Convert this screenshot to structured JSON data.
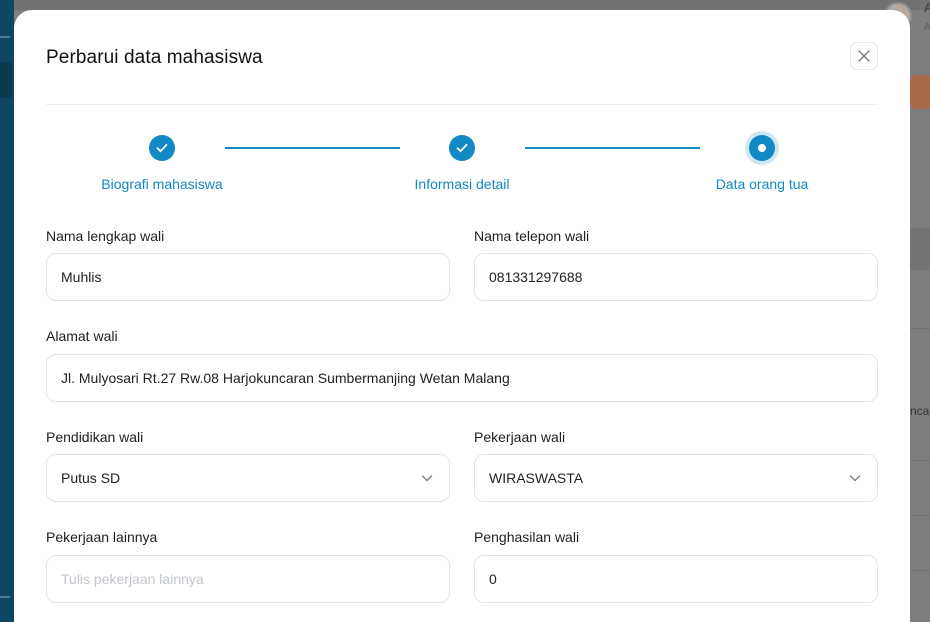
{
  "background": {
    "user_initial": "A",
    "user_sub": "A",
    "partial_text": "ncar"
  },
  "modal": {
    "title": "Perbarui data mahasiswa",
    "close_icon": "close-icon",
    "steps": [
      {
        "label": "Biografi mahasiswa",
        "state": "completed",
        "icon": "check-icon"
      },
      {
        "label": "Informasi detail",
        "state": "completed",
        "icon": "check-icon"
      },
      {
        "label": "Data orang tua",
        "state": "active",
        "icon": "dot-icon"
      }
    ],
    "form": {
      "nama_lengkap_wali": {
        "label": "Nama lengkap wali",
        "value": "Muhlis"
      },
      "nama_telepon_wali": {
        "label": "Nama telepon wali",
        "value": "081331297688"
      },
      "alamat_wali": {
        "label": "Alamat wali",
        "value": "Jl. Mulyosari Rt.27 Rw.08 Harjokuncaran Sumbermanjing Wetan Malang"
      },
      "pendidikan_wali": {
        "label": "Pendidikan wali",
        "value": "Putus SD"
      },
      "pekerjaan_wali": {
        "label": "Pekerjaan wali",
        "value": "WIRASWASTA"
      },
      "pekerjaan_lainnya": {
        "label": "Pekerjaan lainnya",
        "value": "",
        "placeholder": "Tulis pekerjaan lainnya"
      },
      "penghasilan_wali": {
        "label": "Penghasilan wali",
        "value": "0"
      }
    }
  },
  "colors": {
    "accent": "#1288c4",
    "sidebar": "#0d4763",
    "overlay": "#7e7e7e"
  }
}
